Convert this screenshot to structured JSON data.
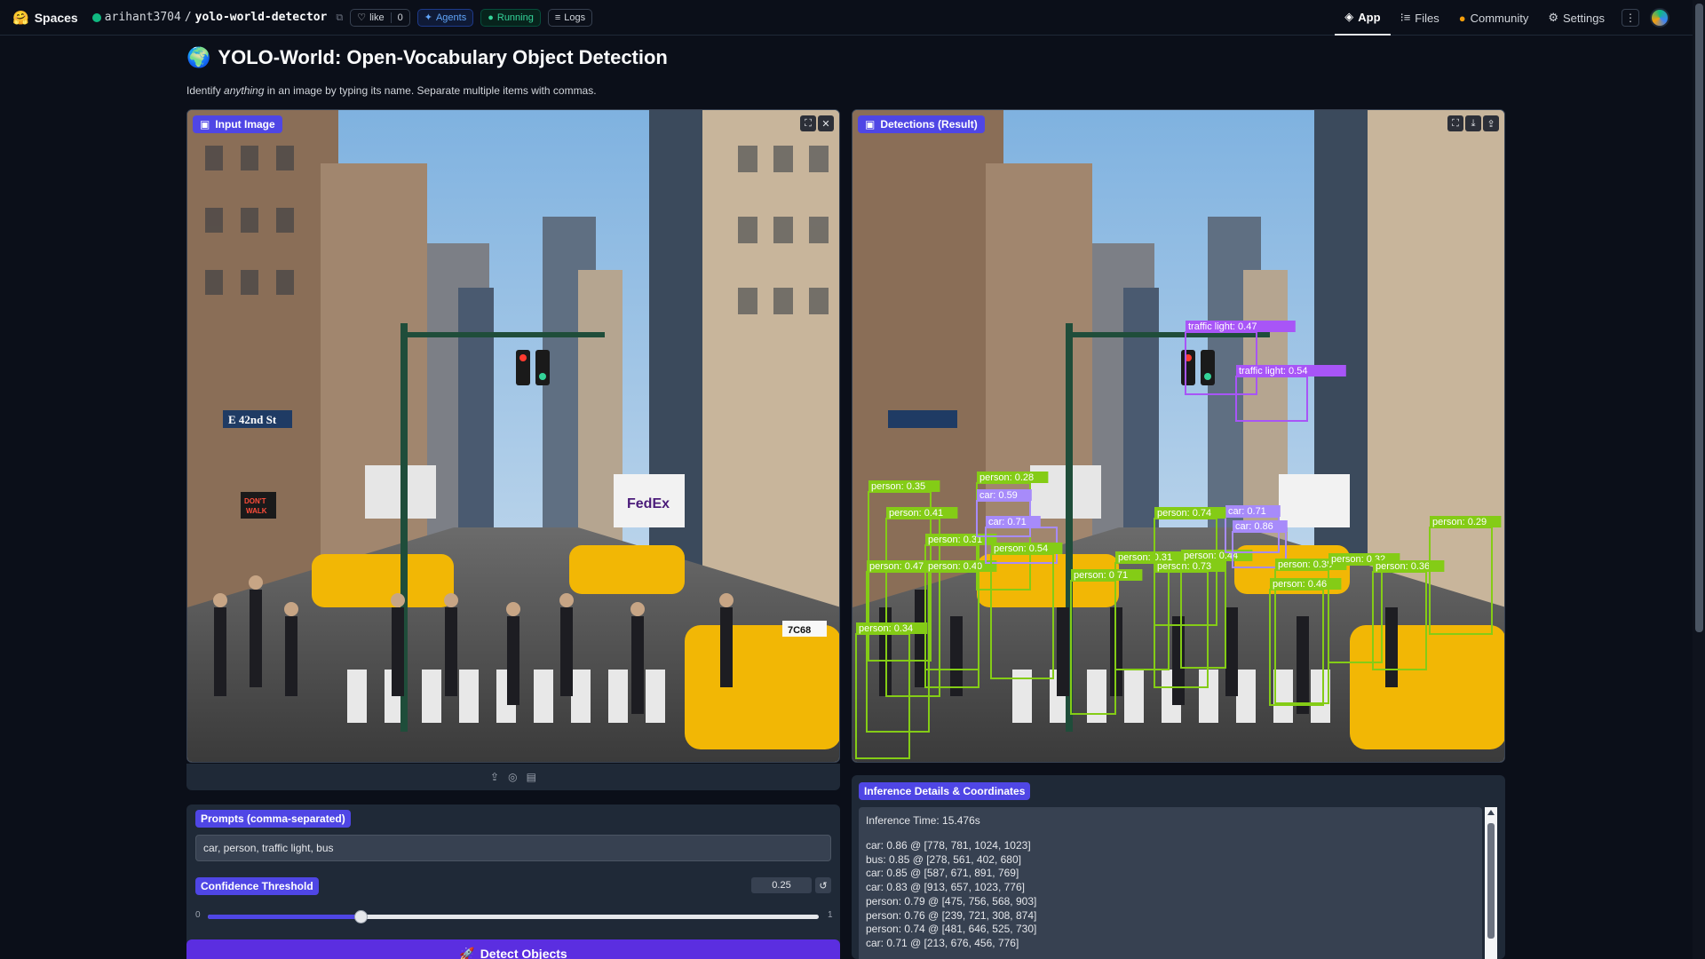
{
  "topbar": {
    "brand": "Spaces",
    "repo_owner": "arihant3704",
    "repo_sep": "/",
    "repo_name": "yolo-world-detector",
    "like_label": "like",
    "like_count": "0",
    "agents_label": "Agents",
    "status_label": "Running",
    "logs_label": "Logs",
    "nav": {
      "app": "App",
      "files": "Files",
      "community": "Community",
      "settings": "Settings"
    }
  },
  "header": {
    "emoji": "🌍",
    "title": "YOLO-World: Open-Vocabulary Object Detection",
    "subtitle_pre": "Identify ",
    "subtitle_em": "anything",
    "subtitle_post": " in an image by typing its name. Separate multiple items with commas."
  },
  "input_panel": {
    "label": "Input Image",
    "sign_street": "E 42nd St",
    "sign_walk_1": "DON'T",
    "sign_walk_2": "WALK",
    "truck_logo": "FedEx",
    "taxi_number": "7C68"
  },
  "result_panel": {
    "label": "Detections (Result)",
    "detections": [
      {
        "label": "traffic light: 0.47",
        "color": "#a855f7"
      },
      {
        "label": "traffic light: 0.54",
        "color": "#a855f7"
      },
      {
        "label": "person: 0.35",
        "color": "#84cc16"
      },
      {
        "label": "person: 0.41",
        "color": "#84cc16"
      },
      {
        "label": "person: 0.31",
        "color": "#84cc16"
      },
      {
        "label": "person: 0.47",
        "color": "#84cc16"
      },
      {
        "label": "person: 0.40",
        "color": "#84cc16"
      },
      {
        "label": "person: 0.34",
        "color": "#84cc16"
      },
      {
        "label": "person: 0.28",
        "color": "#84cc16"
      },
      {
        "label": "car: 0.59",
        "color": "#a78bfa"
      },
      {
        "label": "car: 0.71",
        "color": "#a78bfa"
      },
      {
        "label": "person: 0.54",
        "color": "#84cc16"
      },
      {
        "label": "person: 0.71",
        "color": "#84cc16"
      },
      {
        "label": "person: 0.31",
        "color": "#84cc16"
      },
      {
        "label": "person: 0.73",
        "color": "#84cc16"
      },
      {
        "label": "person: 0.44",
        "color": "#84cc16"
      },
      {
        "label": "car: 0.71",
        "color": "#a78bfa"
      },
      {
        "label": "person: 0.74",
        "color": "#84cc16"
      },
      {
        "label": "car: 0.86",
        "color": "#a78bfa"
      },
      {
        "label": "person: 0.38",
        "color": "#84cc16"
      },
      {
        "label": "person: 0.32",
        "color": "#84cc16"
      },
      {
        "label": "person: 0.46",
        "color": "#84cc16"
      },
      {
        "label": "person: 0.36",
        "color": "#84cc16"
      },
      {
        "label": "person: 0.29",
        "color": "#84cc16"
      }
    ]
  },
  "prompts": {
    "label": "Prompts (comma-separated)",
    "value": "car, person, traffic light, bus"
  },
  "confidence": {
    "label": "Confidence Threshold",
    "value": "0.25",
    "fraction": 0.25,
    "min": "0",
    "max": "1"
  },
  "detect_button": {
    "emoji": "🚀",
    "label": "Detect Objects"
  },
  "details": {
    "label": "Inference Details & Coordinates",
    "time": "Inference Time: 15.476s",
    "lines": [
      "car: 0.86 @ [778, 781, 1024, 1023]",
      "bus: 0.85 @ [278, 561, 402, 680]",
      "car: 0.85 @ [587, 671, 891, 769]",
      "car: 0.83 @ [913, 657, 1023, 776]",
      "person: 0.79 @ [475, 756, 568, 903]",
      "person: 0.76 @ [239, 721, 308, 874]",
      "person: 0.74 @ [481, 646, 525, 730]",
      "car: 0.71 @ [213, 676, 456, 776]"
    ]
  },
  "colors": {
    "accent": "#4f46e5",
    "button": "#5b2ee0",
    "person_box": "#84cc16",
    "car_box": "#a78bfa",
    "traffic_light_box": "#a855f7"
  }
}
